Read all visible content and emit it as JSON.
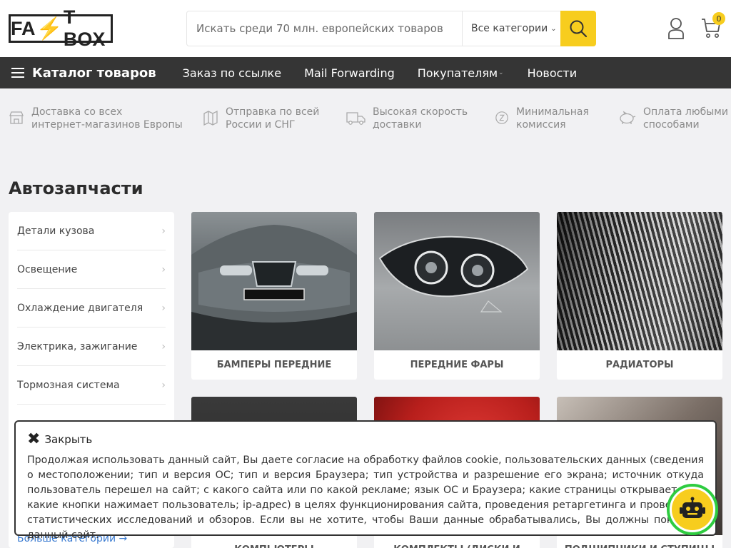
{
  "header": {
    "logo_text_1": "FA",
    "logo_bolt": "⚡",
    "logo_text_2": "T BOX",
    "search_placeholder": "Искать среди 70 млн. европейских товаров",
    "category_select": "Все категории",
    "cart_count": "0"
  },
  "nav": {
    "catalog": "Каталог товаров",
    "items": [
      "Заказ по ссылке",
      "Mail Forwarding",
      "Покупателям",
      "Новости"
    ]
  },
  "features": [
    {
      "icon": "store-icon",
      "line1": "Доставка со всех",
      "line2": "интернет-магазинов Европы"
    },
    {
      "icon": "map-icon",
      "line1": "Отправка по всей",
      "line2": "России и СНГ"
    },
    {
      "icon": "truck-icon",
      "line1": "Высокая скорость",
      "line2": "доставки"
    },
    {
      "icon": "commission-icon",
      "line1": "Минимальная",
      "line2": "комиссия"
    },
    {
      "icon": "piggy-bank-icon",
      "line1": "Оплата любыми",
      "line2": "способами"
    }
  ],
  "section_title": "Автозапчасти",
  "sidebar": {
    "items": [
      "Детали кузова",
      "Освещение",
      "Охлаждение двигателя",
      "Электрика, зажигание",
      "Тормозная система"
    ],
    "more": "Больше категории →"
  },
  "cards": [
    {
      "caption": "Бамперы передние"
    },
    {
      "caption": "Передние фары"
    },
    {
      "caption": "Радиаторы"
    },
    {
      "caption": "Компьютеры"
    },
    {
      "caption": "Комплекты (диски и"
    },
    {
      "caption": "Подшипники и ступицы"
    }
  ],
  "cookie": {
    "close_label": "Закрыть",
    "text": "Продолжая использовать данный сайт, Вы даете согласие на обработку файлов cookie, пользовательских данных (сведения о местоположении; тип и версия ОС; тип и версия Браузера; тип устройства и разрешение его экрана; источник откуда пользователь перешел на сайт; с какого сайта или по какой рекламе; язык ОС и Браузера; какие страницы открывает и на какие кнопки нажимает пользователь; ip-адрес) в целях функционирования сайта, проведения ретаргетинга и проведения статистических исследований и обзоров. Если вы не хотите, чтобы Ваши данные обрабатывались, Вы должны покинуть данный сайт."
  },
  "colors": {
    "accent": "#f7cd1e",
    "nav_bg": "#353535",
    "page_bg": "#f1f1f3",
    "link": "#3b7bd1",
    "bot_ring": "#2ecc40"
  }
}
